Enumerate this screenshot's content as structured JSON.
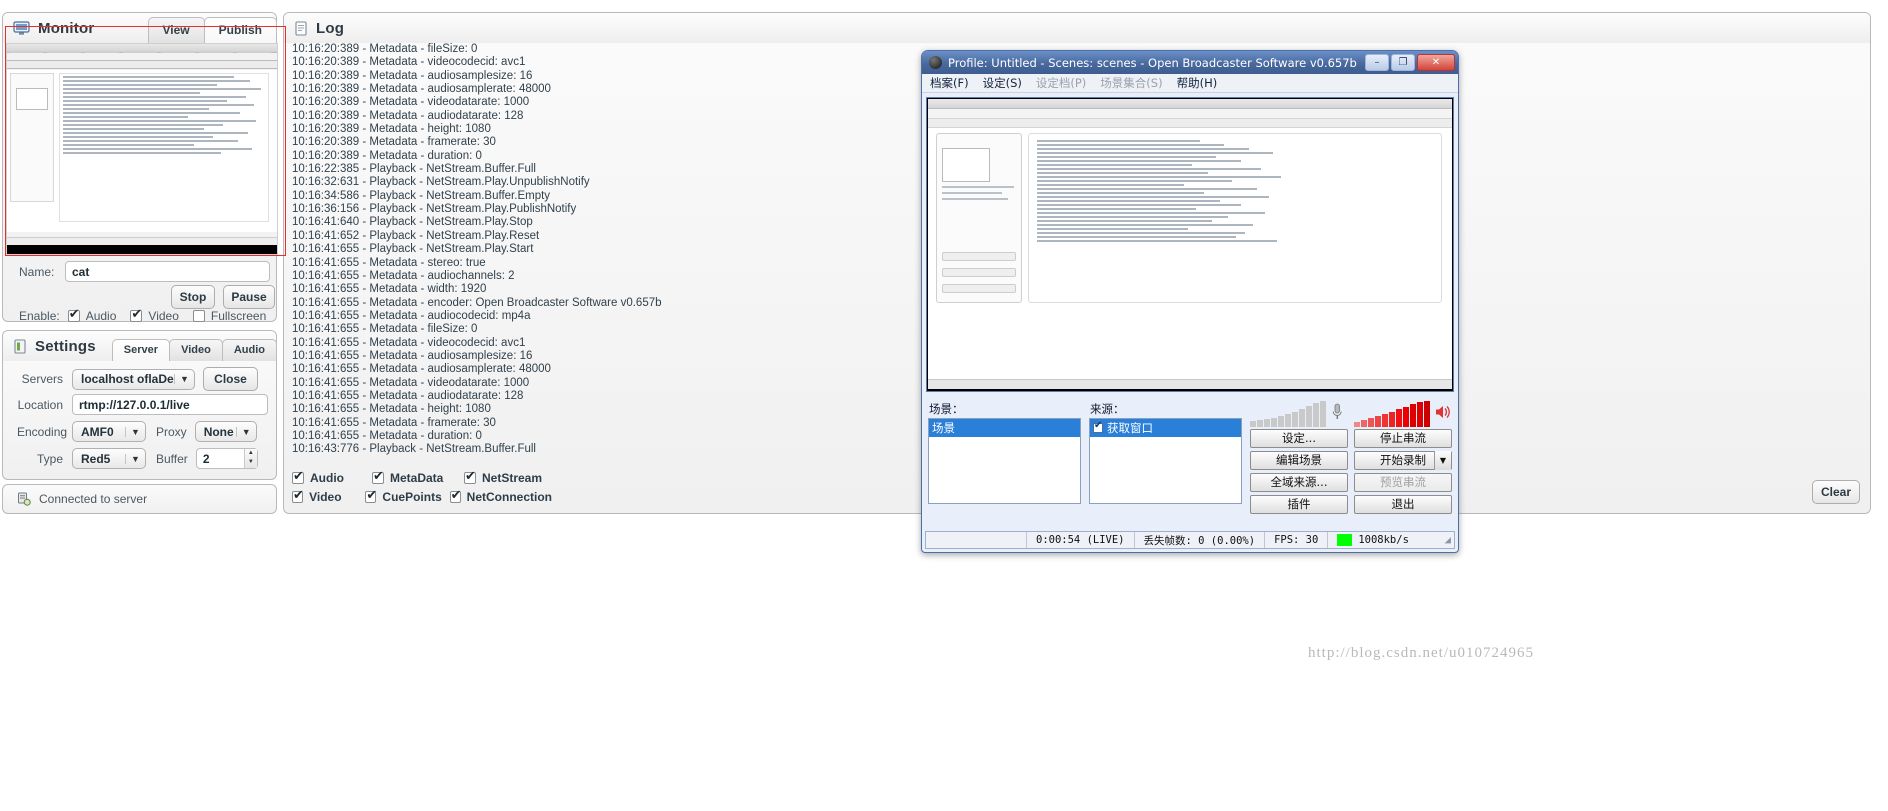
{
  "monitor": {
    "title": "Monitor",
    "icon": "monitor-icon",
    "tabs": [
      {
        "label": "View",
        "active": false
      },
      {
        "label": "Publish",
        "active": true
      }
    ],
    "name_label": "Name:",
    "name_value": "cat",
    "name_placeholder": "",
    "stop_label": "Stop",
    "pause_label": "Pause",
    "enable_label": "Enable:",
    "enables": [
      {
        "label": "Audio",
        "checked": true
      },
      {
        "label": "Video",
        "checked": true
      },
      {
        "label": "Fullscreen",
        "checked": false
      }
    ]
  },
  "settings": {
    "title": "Settings",
    "icon": "settings-icon",
    "tabs": [
      {
        "label": "Server",
        "active": true
      },
      {
        "label": "Video",
        "active": false
      },
      {
        "label": "Audio",
        "active": false
      }
    ],
    "servers_label": "Servers",
    "servers_value": "localhost oflaDemo",
    "close_label": "Close",
    "location_label": "Location",
    "location_value": "rtmp://127.0.0.1/live",
    "encoding_label": "Encoding",
    "encoding_value": "AMF0",
    "proxy_label": "Proxy",
    "proxy_value": "None",
    "type_label": "Type",
    "type_value": "Red5",
    "buffer_label": "Buffer",
    "buffer_value": "2"
  },
  "status": {
    "icon": "server-connected-icon",
    "text": "Connected to server"
  },
  "log": {
    "title": "Log",
    "icon": "log-icon",
    "clear_label": "Clear",
    "filters": [
      {
        "label": "Audio",
        "checked": true
      },
      {
        "label": "MetaData",
        "checked": true
      },
      {
        "label": "NetStream",
        "checked": true
      },
      {
        "label": "Video",
        "checked": true
      },
      {
        "label": "CuePoints",
        "checked": true
      },
      {
        "label": "NetConnection",
        "checked": true
      }
    ],
    "lines": [
      "10:16:20:389 - Metadata - fileSize: 0",
      "10:16:20:389 - Metadata - videocodecid: avc1",
      "10:16:20:389 - Metadata - audiosamplesize: 16",
      "10:16:20:389 - Metadata - audiosamplerate: 48000",
      "10:16:20:389 - Metadata - videodatarate: 1000",
      "10:16:20:389 - Metadata - audiodatarate: 128",
      "10:16:20:389 - Metadata - height: 1080",
      "10:16:20:389 - Metadata - framerate: 30",
      "10:16:20:389 - Metadata - duration: 0",
      "10:16:22:385 - Playback - NetStream.Buffer.Full",
      "10:16:32:631 - Playback - NetStream.Play.UnpublishNotify",
      "10:16:34:586 - Playback - NetStream.Buffer.Empty",
      "10:16:36:156 - Playback - NetStream.Play.PublishNotify",
      "10:16:41:640 - Playback - NetStream.Play.Stop",
      "10:16:41:652 - Playback - NetStream.Play.Reset",
      "10:16:41:655 - Playback - NetStream.Play.Start",
      "10:16:41:655 - Metadata - stereo: true",
      "10:16:41:655 - Metadata - audiochannels: 2",
      "10:16:41:655 - Metadata - width: 1920",
      "10:16:41:655 - Metadata - encoder: Open Broadcaster Software v0.657b",
      "10:16:41:655 - Metadata - audiocodecid: mp4a",
      "10:16:41:655 - Metadata - fileSize: 0",
      "10:16:41:655 - Metadata - videocodecid: avc1",
      "10:16:41:655 - Metadata - audiosamplesize: 16",
      "10:16:41:655 - Metadata - audiosamplerate: 48000",
      "10:16:41:655 - Metadata - videodatarate: 1000",
      "10:16:41:655 - Metadata - audiodatarate: 128",
      "10:16:41:655 - Metadata - height: 1080",
      "10:16:41:655 - Metadata - framerate: 30",
      "10:16:41:655 - Metadata - duration: 0",
      "10:16:43:776 - Playback - NetStream.Buffer.Full"
    ]
  },
  "obs": {
    "window_title": "Profile: Untitled - Scenes: scenes - Open Broadcaster Software v0.657b",
    "window_buttons": {
      "minimize": "–",
      "maximize": "❐",
      "close": "✕"
    },
    "menu": [
      {
        "label": "档案(F)",
        "disabled": false
      },
      {
        "label": "设定(S)",
        "disabled": false
      },
      {
        "label": "设定档(P)",
        "disabled": true
      },
      {
        "label": "场景集合(S)",
        "disabled": true
      },
      {
        "label": "帮助(H)",
        "disabled": false
      }
    ],
    "scenes_label": "场景：",
    "scene_items": [
      "场景"
    ],
    "sources_label": "来源：",
    "source_items": [
      {
        "label": "获取窗口",
        "checked": true
      }
    ],
    "buttons_left": [
      "设定...",
      "编辑场景",
      "全域来源...",
      "插件"
    ],
    "buttons_right": [
      {
        "label": "停止串流",
        "disabled": false,
        "dropdown": false
      },
      {
        "label": "开始录制",
        "disabled": false,
        "dropdown": true
      },
      {
        "label": "预览串流",
        "disabled": true,
        "dropdown": false
      },
      {
        "label": "退出",
        "disabled": false,
        "dropdown": false
      }
    ],
    "status": {
      "time": "0:00:54 (LIVE)",
      "dropped": "丢失帧数: 0 (0.00%)",
      "fps": "FPS: 30",
      "bitrate": "1008kb/s",
      "indicator_color": "#00ff00"
    },
    "mic_icon": "microphone-icon",
    "speaker_icon": "speaker-icon"
  },
  "watermark": "http://blog.csdn.net/u010724965",
  "colors": {
    "accent": "#2a7fd8",
    "red_outline": "#e8302a",
    "title_blue": "#49699e",
    "green": "#00ff00"
  }
}
